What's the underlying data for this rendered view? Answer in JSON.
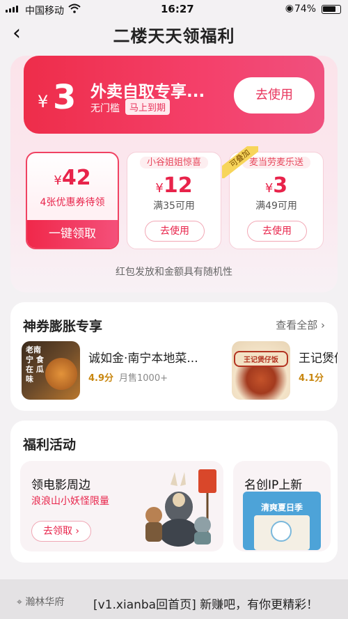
{
  "status": {
    "carrier": "中国移动",
    "time": "16:27",
    "battery": "74%"
  },
  "nav": {
    "title": "二楼天天领福利"
  },
  "top_coupon": {
    "yen": "¥",
    "amount": "3",
    "name": "外卖自取专享...",
    "sub": "无门槛",
    "tag": "马上到期",
    "button": "去使用"
  },
  "coupons": [
    {
      "yen": "¥",
      "value": "42",
      "desc": "4张优惠券待领",
      "button": "一键领取"
    },
    {
      "header": "小谷姐姐惊喜",
      "yen": "¥",
      "value": "12",
      "cond": "满35可用",
      "button": "去使用"
    },
    {
      "header": "麦当劳麦乐送",
      "badge": "可叠加",
      "yen": "¥",
      "value": "3",
      "cond": "满49可用",
      "button": "去使用"
    }
  ],
  "note": "红包发放和金额具有随机性",
  "section1": {
    "title": "神券膨胀专享",
    "more": "查看全部 ›",
    "shops": [
      {
        "name": "诚如金·南宁本地菜...",
        "score": "4.9分",
        "sold": "月售1000+",
        "img_text": "老南宁 食在 瓜味"
      },
      {
        "name": "王记煲仔",
        "score": "4.1分",
        "sold": "",
        "img_text": "王记煲仔饭"
      }
    ]
  },
  "section2": {
    "title": "福利活动",
    "activities": [
      {
        "title": "领电影周边",
        "sub": "浪浪山小妖怪限量",
        "button": "去领取 ›"
      },
      {
        "title": "名创IP上新",
        "poster_title": "清爽夏日季"
      }
    ]
  },
  "bottom": {
    "location": "瀚林华府",
    "text": "[v1.xianba回首页] 新赚吧，有你更精彩！"
  },
  "colors": {
    "accent": "#e8234a",
    "hero_bg": "#fbe3ea"
  }
}
